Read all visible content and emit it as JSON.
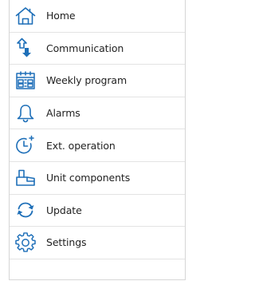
{
  "menu": {
    "items": [
      {
        "label": "Home",
        "icon": "home-icon"
      },
      {
        "label": "Communication",
        "icon": "communication-icon"
      },
      {
        "label": "Weekly program",
        "icon": "calendar-icon"
      },
      {
        "label": "Alarms",
        "icon": "bell-icon"
      },
      {
        "label": "Ext. operation",
        "icon": "clock-plus-icon"
      },
      {
        "label": "Unit components",
        "icon": "unit-components-icon"
      },
      {
        "label": "Update",
        "icon": "refresh-icon"
      },
      {
        "label": "Settings",
        "icon": "gear-icon"
      }
    ]
  },
  "colors": {
    "accent": "#1e6fb8",
    "text": "#222222",
    "divider": "#e3e3e3"
  }
}
